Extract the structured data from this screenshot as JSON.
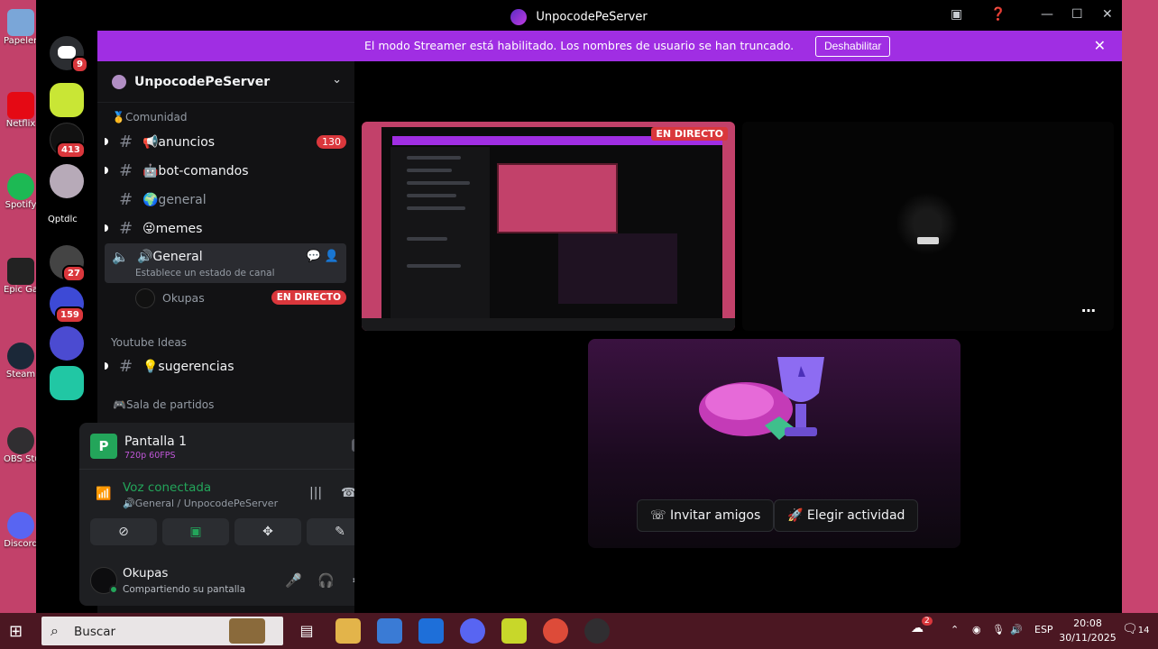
{
  "window": {
    "title": "UnpocodePeServer"
  },
  "streamer_bar": {
    "message": "El modo Streamer está habilitado. Los nombres de usuario se han truncado.",
    "disable_label": "Deshabilitar"
  },
  "desktop_icons": [
    {
      "label": "Papelera recicl",
      "color": "#7aa6d8"
    },
    {
      "label": "Netflix",
      "color": "#e50914"
    },
    {
      "label": "Spotify",
      "color": "#1db954"
    },
    {
      "label": "Epic Games Launcher",
      "color": "#222222"
    },
    {
      "label": "Steam",
      "color": "#1b2838"
    },
    {
      "label": "OBS Studio",
      "color": "#302e31"
    },
    {
      "label": "Discord",
      "color": "#5865f2"
    }
  ],
  "rail": {
    "home_badge": "9",
    "items": [
      {
        "name": "server-1",
        "color": "#c9e635",
        "badge": ""
      },
      {
        "name": "server-2",
        "color": "#111111",
        "badge": "413"
      },
      {
        "name": "server-3",
        "color": "#b7aab8",
        "badge": ""
      },
      {
        "name": "server-4",
        "label": "Qptdlc",
        "color": "#000000",
        "badge": ""
      },
      {
        "name": "server-5",
        "color": "#444444",
        "badge": "27"
      },
      {
        "name": "server-6",
        "color": "#3d4ad6",
        "badge": "159"
      },
      {
        "name": "server-7",
        "color": "#4b4bd1",
        "badge": ""
      },
      {
        "name": "server-8",
        "color": "#21c7a4",
        "badge": ""
      }
    ]
  },
  "sidebar": {
    "server_name": "UnpocodePeServer",
    "categories": {
      "comunidad": "🥇Comunidad",
      "youtube": "Youtube Ideas",
      "sala": "🎮Sala de partidos"
    },
    "channels": [
      {
        "name": "📢anuncios",
        "badge": "130"
      },
      {
        "name": "🤖bot-comandos",
        "badge": ""
      },
      {
        "name": "🌍general",
        "badge": ""
      },
      {
        "name": "😜memes",
        "badge": ""
      }
    ],
    "voice_channel": {
      "name": "🔊General",
      "status": "Establece un estado de canal"
    },
    "voice_user": {
      "name": "Okupas",
      "live": "EN DIRECTO"
    },
    "youtube_channel": "💡sugerencias"
  },
  "panel": {
    "stream_name": "Pantalla 1",
    "stream_quality": "720p 60FPS",
    "voice_title": "Voz conectada",
    "voice_sub": "🔊General / UnpocodePeServer",
    "user_name": "Okupas",
    "user_status": "Compartiendo su pantalla"
  },
  "stage": {
    "live_tag": "EN DIRECTO",
    "invite_label": "Invitar amigos",
    "activity_label": "Elegir actividad"
  },
  "taskbar": {
    "search_placeholder": "Buscar",
    "language": "ESP",
    "time": "20:08",
    "date": "30/11/2025",
    "notifications": "14",
    "weather_badge": "2"
  }
}
